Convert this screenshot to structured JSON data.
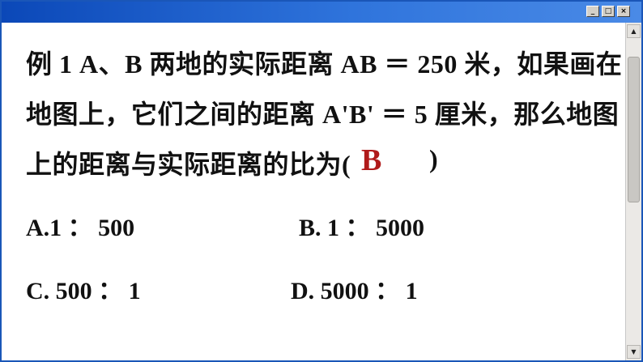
{
  "window": {
    "buttons": {
      "minimize": "_",
      "maximize": "□",
      "close": "×"
    }
  },
  "scrollbar": {
    "up_arrow": "▲",
    "down_arrow": "▼"
  },
  "question": {
    "line1": "例 1 A、B  两地的实际距离 AB  ＝  250  米，如果画在",
    "line2": "地图上，它们之间的距离 A'B'  ＝  5  厘米，那么地图",
    "line3": "上的距离与实际距离的比为(",
    "answer": "B",
    "close_paren": ")"
  },
  "options": {
    "a": "A.1  ：  500",
    "b": "B. 1  ：  5000",
    "c": "C. 500  ：  1",
    "d": "D. 5000  ：  1"
  },
  "colors": {
    "titlebar": "#2f74dc",
    "answer": "#b01a1a",
    "text": "#111111"
  }
}
